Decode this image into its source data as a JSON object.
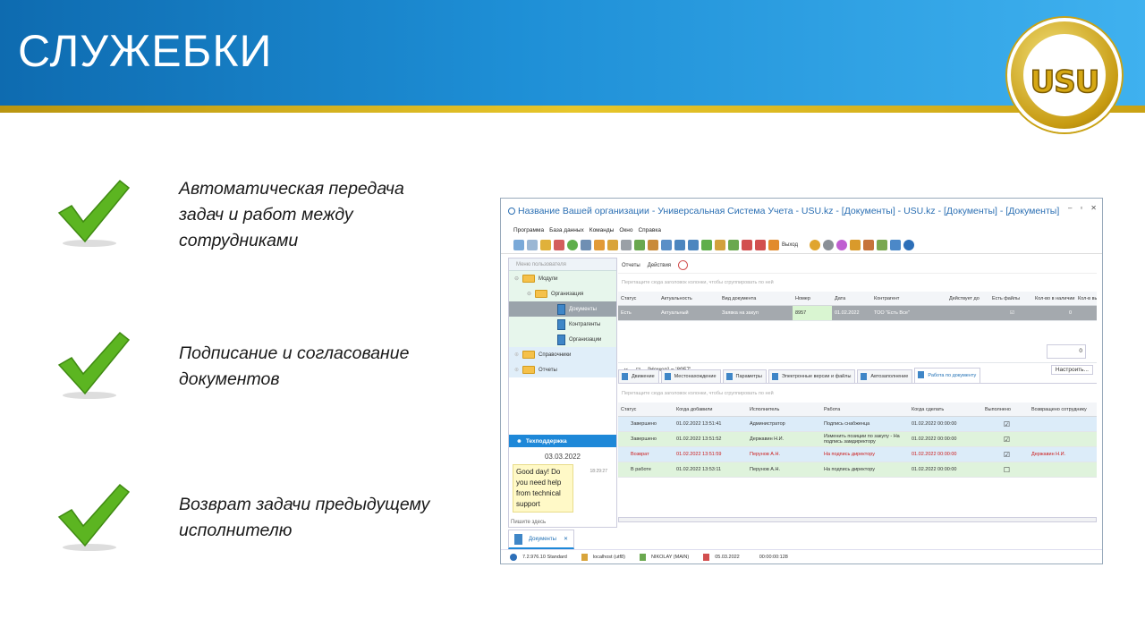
{
  "slide": {
    "title": "СЛУЖЕБКИ",
    "logo_text": "USU",
    "bullets": [
      {
        "text": "Автоматическая передача задач и работ между сотрудниками"
      },
      {
        "text": "Подписание и согласование документов"
      },
      {
        "text": "Возврат задачи предыдущему исполнителю"
      }
    ]
  },
  "window": {
    "title": "Название Вашей организации - Универсальная Система Учета - USU.kz - [Документы] - USU.kz - [Документы] - [Документы]",
    "menu": [
      "Программа",
      "База данных",
      "Команды",
      "Окно",
      "Справка"
    ],
    "exit_label": "Выход",
    "left_panel": {
      "header": "Меню пользователя",
      "tree": [
        {
          "label": "Модули",
          "level": 0,
          "type": "folder"
        },
        {
          "label": "Организация",
          "level": 1,
          "type": "folder"
        },
        {
          "label": "Документы",
          "level": 2,
          "type": "doc",
          "selected": true
        },
        {
          "label": "Контрагенты",
          "level": 2,
          "type": "doc"
        },
        {
          "label": "Организации",
          "level": 2,
          "type": "doc"
        },
        {
          "label": "Справочники",
          "level": 0,
          "type": "folder"
        },
        {
          "label": "Отчеты",
          "level": 0,
          "type": "folder"
        }
      ]
    },
    "support": {
      "header": "Техподдержка",
      "date": "03.03.2022",
      "time": "18:29:27",
      "message": "Good day! Do you need help from technical support",
      "input_placeholder": "Пишите здесь"
    },
    "toolbar2": {
      "reports": "Отчеты",
      "actions": "Действия"
    },
    "group_hint": "Перетащите сюда заголовок колонки, чтобы сгруппировать по ней",
    "top_grid": {
      "columns": [
        "Статус",
        "Актуальность",
        "Вид документа",
        "Номер",
        "Дата",
        "Контрагент",
        "Действует до",
        "Есть файлы",
        "Кол-во в наличии",
        "Кол-в выда"
      ],
      "row": [
        "Есть",
        "Актуальный",
        "Заявка на закуп",
        "8957",
        "01.02.2022",
        "ТОО \"Есть Все\"",
        "",
        "☑",
        "0",
        ""
      ],
      "total": "0",
      "filter": "[Номер] = '8957'",
      "settings_button": "Настроить..."
    },
    "tabs": [
      "Движение",
      "Местонахождение",
      "Параметры",
      "Электронные версии и файлы",
      "Автозаполнение",
      "Работа по документу"
    ],
    "bottom_grid": {
      "columns": [
        "Статус",
        "Когда добавили",
        "Исполнитель",
        "Работа",
        "Когда сделать",
        "Выполнено",
        "Возвращено сотруднику"
      ],
      "rows": [
        {
          "status": "Завершено",
          "added": "01.02.2022 13:51:41",
          "executor": "Администратор",
          "work": "Подпись снабженца",
          "due": "01.02.2022 00:00:00",
          "done": "☑",
          "returned": "",
          "style": "blue"
        },
        {
          "status": "Завершено",
          "added": "01.02.2022 13:51:52",
          "executor": "Державин Н.И.",
          "work": "Изменить позиции по закупу - На подпись замдиректору",
          "due": "01.02.2022 00:00:00",
          "done": "☑",
          "returned": "",
          "style": "green"
        },
        {
          "status": "Возврат",
          "added": "01.02.2022 13:51:59",
          "executor": "Перунов А.Н.",
          "work": "На подпись директору",
          "due": "01.02.2022 00:00:00",
          "done": "☑",
          "returned": "Державин Н.И.",
          "style": "red"
        },
        {
          "status": "В работе",
          "added": "01.02.2022 13:53:11",
          "executor": "Перунов А.Н.",
          "work": "На подпись директору",
          "due": "01.02.2022 00:00:00",
          "done": "☐",
          "returned": "",
          "style": "green"
        }
      ]
    },
    "doc_tab": "Документы",
    "status_bar": [
      "7.2.976.10 Standard",
      "localhost (utf8)",
      "NIKOLAY (MAIN)",
      "05.03.2022",
      "00:00:00:128"
    ]
  }
}
